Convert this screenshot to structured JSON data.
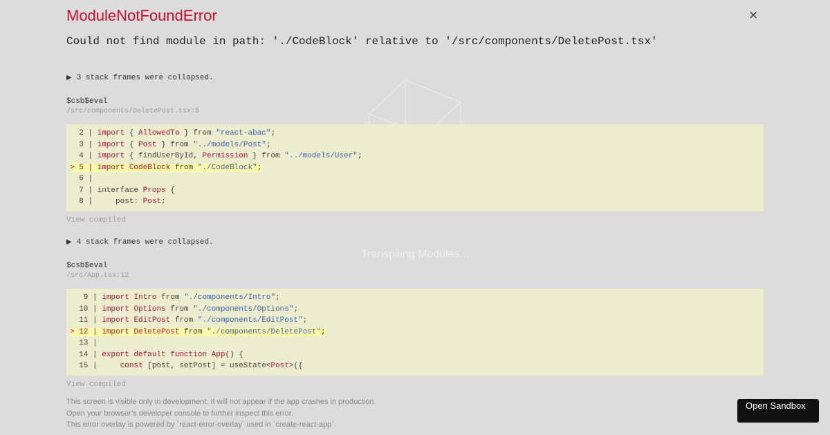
{
  "error": {
    "title": "ModuleNotFoundError",
    "message": "Could not find module in path: './CodeBlock' relative to '/src/components/DeletePost.tsx'",
    "close_glyph": "×"
  },
  "frames": [
    {
      "collapsed_text": "3 stack frames were collapsed.",
      "function": "$csb$eval",
      "location": "/src/components/DeletePost.tsx:5",
      "view_compiled": "View compiled",
      "lines": [
        {
          "prefix": "  2 | ",
          "tokens": [
            [
              "kw",
              "import"
            ],
            [
              "p",
              " { "
            ],
            [
              "ty",
              "AllowedTo"
            ],
            [
              "p",
              " } from "
            ],
            [
              "str",
              "\"react-abac\""
            ],
            [
              "p",
              ";"
            ]
          ],
          "highlight": false
        },
        {
          "prefix": "  3 | ",
          "tokens": [
            [
              "kw",
              "import"
            ],
            [
              "p",
              " { "
            ],
            [
              "ty",
              "Post"
            ],
            [
              "p",
              " } from "
            ],
            [
              "str",
              "\"../models/Post\""
            ],
            [
              "p",
              ";"
            ]
          ],
          "highlight": false
        },
        {
          "prefix": "  4 | ",
          "tokens": [
            [
              "kw",
              "import"
            ],
            [
              "p",
              " { findUserById, "
            ],
            [
              "ty",
              "Permission"
            ],
            [
              "p",
              " } from "
            ],
            [
              "str",
              "\"../models/User\""
            ],
            [
              "p",
              ";"
            ]
          ],
          "highlight": false
        },
        {
          "prefix": "> 5 | ",
          "tokens": [
            [
              "kw",
              "import"
            ],
            [
              "p",
              " "
            ],
            [
              "ty",
              "CodeBlock"
            ],
            [
              "p",
              " from "
            ],
            [
              "str",
              "\"./CodeBlock\""
            ],
            [
              "p",
              ";"
            ]
          ],
          "highlight": true
        },
        {
          "prefix": "  6 | ",
          "tokens": [],
          "highlight": false
        },
        {
          "prefix": "  7 | ",
          "tokens": [
            [
              "p",
              "interface "
            ],
            [
              "ty",
              "Props"
            ],
            [
              "p",
              " {"
            ]
          ],
          "highlight": false
        },
        {
          "prefix": "  8 | ",
          "tokens": [
            [
              "p",
              "    post: "
            ],
            [
              "ty",
              "Post"
            ],
            [
              "p",
              ";"
            ]
          ],
          "highlight": false
        }
      ]
    },
    {
      "collapsed_text": "4 stack frames were collapsed.",
      "function": "$csb$eval",
      "location": "/src/App.tsx:12",
      "view_compiled": "View compiled",
      "lines": [
        {
          "prefix": "   9 | ",
          "tokens": [
            [
              "kw",
              "import"
            ],
            [
              "p",
              " "
            ],
            [
              "ty",
              "Intro"
            ],
            [
              "p",
              " from "
            ],
            [
              "str",
              "\"./components/Intro\""
            ],
            [
              "p",
              ";"
            ]
          ],
          "highlight": false
        },
        {
          "prefix": "  10 | ",
          "tokens": [
            [
              "kw",
              "import"
            ],
            [
              "p",
              " "
            ],
            [
              "ty",
              "Options"
            ],
            [
              "p",
              " from "
            ],
            [
              "str",
              "\"./components/Options\""
            ],
            [
              "p",
              ";"
            ]
          ],
          "highlight": false
        },
        {
          "prefix": "  11 | ",
          "tokens": [
            [
              "kw",
              "import"
            ],
            [
              "p",
              " "
            ],
            [
              "ty",
              "EditPost"
            ],
            [
              "p",
              " from "
            ],
            [
              "str",
              "\"./components/EditPost\""
            ],
            [
              "p",
              ";"
            ]
          ],
          "highlight": false
        },
        {
          "prefix": "> 12 | ",
          "tokens": [
            [
              "kw",
              "import"
            ],
            [
              "p",
              " "
            ],
            [
              "ty",
              "DeletePost"
            ],
            [
              "p",
              " from "
            ],
            [
              "str",
              "\"./components/DeletePost\""
            ],
            [
              "p",
              ";"
            ]
          ],
          "highlight": true
        },
        {
          "prefix": "  13 | ",
          "tokens": [],
          "highlight": false
        },
        {
          "prefix": "  14 | ",
          "tokens": [
            [
              "kw",
              "export default function"
            ],
            [
              "p",
              " "
            ],
            [
              "ty",
              "App"
            ],
            [
              "p",
              "() {"
            ]
          ],
          "highlight": false
        },
        {
          "prefix": "  15 | ",
          "tokens": [
            [
              "p",
              "    "
            ],
            [
              "kw",
              "const"
            ],
            [
              "p",
              " [post, setPost] = useState<"
            ],
            [
              "ty",
              "Post"
            ],
            [
              "p",
              ">({"
            ]
          ],
          "highlight": false
        }
      ]
    }
  ],
  "footer": {
    "line1": "This screen is visible only in development. It will not appear if the app crashes in production.",
    "line2": "Open your browser’s developer console to further inspect this error.",
    "line3": "This error overlay is powered by `react-error-overlay` used in `create-react-app`."
  },
  "loading_text": "Transpiling Modules...",
  "sandbox_button": "Open Sandbox",
  "colors": {
    "error_red": "#c8102e",
    "code_background": "#ececcf",
    "highlight": "#fffaa8",
    "keyword": "#a6193d",
    "string": "#3a63a8"
  },
  "icons": {
    "close": "close-icon",
    "collapse": "triangle-right-icon",
    "loader": "cube-loader-icon"
  }
}
